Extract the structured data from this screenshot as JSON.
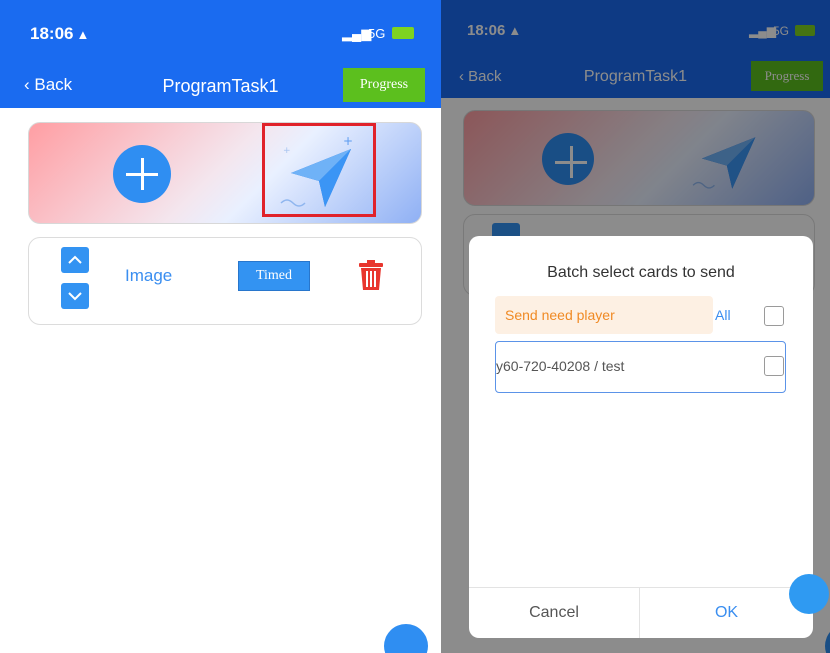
{
  "left": {
    "status": {
      "time": "18:06",
      "signal": "5G"
    },
    "nav": {
      "back_label": "Back",
      "title": "ProgramTask1",
      "progress_label": "Progress"
    },
    "item": {
      "label": "Image",
      "timed_label": "Timed"
    }
  },
  "right": {
    "status": {
      "time": "18:06",
      "signal": "5G"
    },
    "nav": {
      "back_label": "Back",
      "title": "ProgramTask1",
      "progress_label": "Progress"
    },
    "dialog": {
      "title": "Batch select cards to send",
      "need_player": "Send need player",
      "all_label": "All",
      "card": "y60-720-40208 / test",
      "cancel": "Cancel",
      "ok": "OK"
    }
  },
  "colors": {
    "header_blue": "#1a6bf0",
    "accent_green": "#5cbf1e",
    "highlight_red": "#e0222a"
  }
}
